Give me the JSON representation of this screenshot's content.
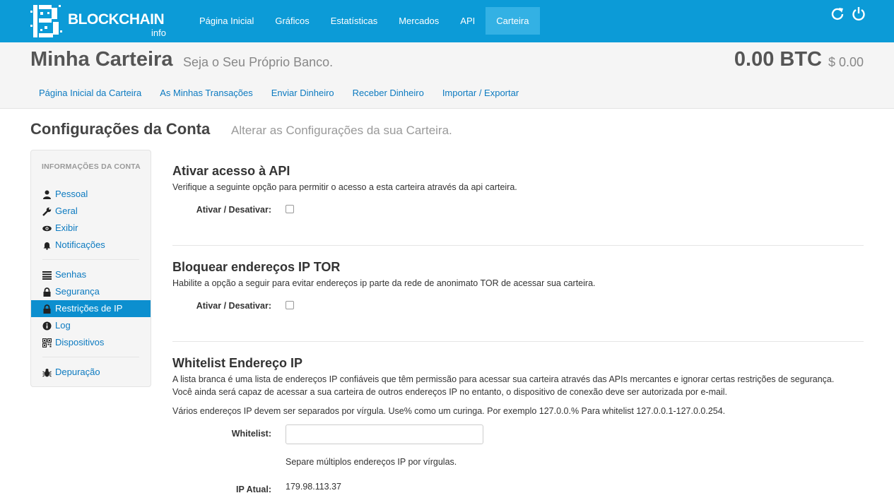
{
  "brand": {
    "name": "BLOCKCHAIN",
    "sub": "info"
  },
  "nav": [
    {
      "label": "Página Inicial"
    },
    {
      "label": "Gráficos"
    },
    {
      "label": "Estatísticas"
    },
    {
      "label": "Mercados"
    },
    {
      "label": "API"
    },
    {
      "label": "Carteira",
      "active": true
    }
  ],
  "wallet": {
    "title": "Minha Carteira",
    "subtitle": "Seja o Seu Próprio Banco.",
    "balance_btc": "0.00 BTC",
    "balance_usd": "$ 0.00",
    "tabs": [
      "Página Inicial da Carteira",
      "As Minhas Transações",
      "Enviar Dinheiro",
      "Receber Dinheiro",
      "Importar / Exportar"
    ]
  },
  "page": {
    "title": "Configurações da Conta",
    "subtitle": "Alterar as Configurações da sua Carteira."
  },
  "sidebar": {
    "header": "INFORMAÇÕES DA CONTA",
    "items": [
      {
        "label": "Pessoal",
        "icon": "user-icon"
      },
      {
        "label": "Geral",
        "icon": "wrench-icon"
      },
      {
        "label": "Exibir",
        "icon": "eye-icon"
      },
      {
        "label": "Notificações",
        "icon": "bell-icon"
      },
      {
        "label": "Senhas",
        "icon": "list-icon"
      },
      {
        "label": "Segurança",
        "icon": "lock-icon"
      },
      {
        "label": "Restrições de IP",
        "icon": "lock-icon",
        "active": true
      },
      {
        "label": "Log",
        "icon": "info-icon"
      },
      {
        "label": "Dispositivos",
        "icon": "qrcode-icon"
      },
      {
        "label": "Depuração",
        "icon": "bug-icon"
      }
    ]
  },
  "sections": {
    "api": {
      "title": "Ativar acesso à API",
      "desc": "Verifique a seguinte opção para permitir o acesso a esta carteira através da api carteira.",
      "toggle_label": "Ativar / Desativar:",
      "checked": false
    },
    "tor": {
      "title": "Bloquear endereços IP TOR",
      "desc": "Habilite a opção a seguir para evitar endereços ip parte da rede de anonimato TOR de acessar sua carteira.",
      "toggle_label": "Ativar / Desativar:",
      "checked": false
    },
    "whitelist": {
      "title": "Whitelist Endereço IP",
      "desc1": "A lista branca é uma lista de endereços IP confiáveis que têm permissão para acessar sua carteira através das APIs mercantes e ignorar certas restrições de segurança.",
      "desc2": "Você ainda será capaz de acessar a sua carteira de outros endereços IP no entanto, o dispositivo de conexão deve ser autorizada por e-mail.",
      "desc3": "Vários endereços IP devem ser separados por vírgula. Use% como um curinga. Por exemplo 127.0.0.% Para whitelist 127.0.0.1-127.0.0.254.",
      "field_label": "Whitelist:",
      "value": "",
      "help": "Separe múltiplos endereços IP por vírgulas.",
      "current_ip_label": "IP Atual:",
      "current_ip": "179.98.113.37"
    }
  },
  "colors": {
    "brand": "#0c9bd7",
    "link": "#0c7ac0",
    "active": "#0c8fcf"
  }
}
